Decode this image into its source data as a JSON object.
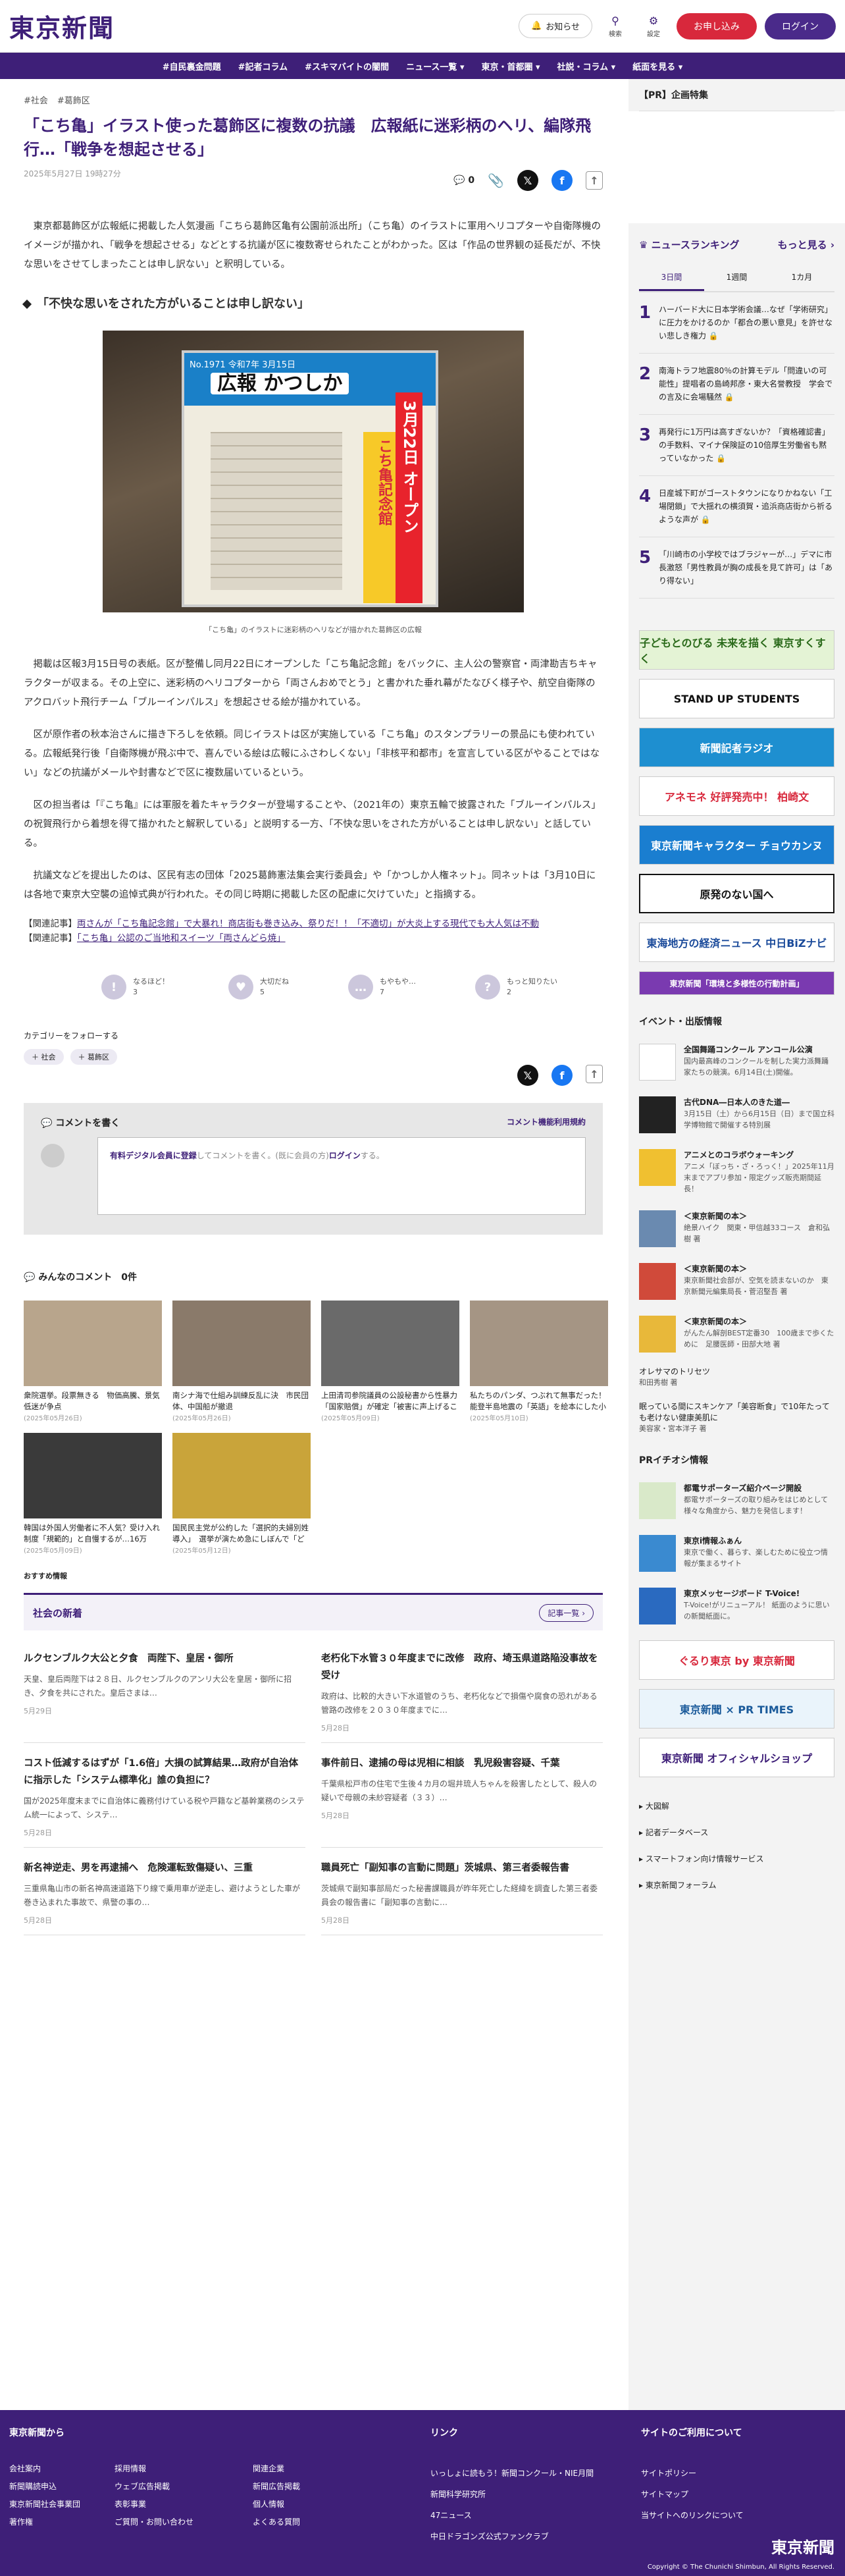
{
  "header": {
    "logo": "東京新聞",
    "notice": "お知らせ",
    "search": "検索",
    "settings": "設定",
    "subscribe": "お申し込み",
    "login": "ログイン"
  },
  "nav": [
    "#自民裏金問題",
    "#記者コラム",
    "#スキマバイトの闇間",
    "ニュース一覧 ▾",
    "東京・首都圏 ▾",
    "社説・コラム ▾",
    "紙面を見る ▾"
  ],
  "article": {
    "tags": [
      "#社会",
      "#葛飾区"
    ],
    "title": "「こち亀」イラスト使った葛飾区に複数の抗議　広報紙に迷彩柄のヘリ、編隊飛行…「戦争を想起させる」",
    "date": "2025年5月27日 19時27分",
    "comment_count": "0",
    "p1": "東京都葛飾区が広報紙に掲載した人気漫画「こちら葛飾区亀有公園前派出所」（こち亀）のイラストに軍用ヘリコプターや自衛隊機のイメージが描かれ、「戦争を想起させる」などとする抗議が区に複数寄せられたことがわかった。区は「作品の世界観の延長だが、不快な思いをさせてしまったことは申し訳ない」と釈明している。",
    "h2": "「不快な思いをされた方がいることは申し訳ない」",
    "photo": {
      "issue": "No.1971 令和7年 3月15日",
      "flyer_title": "広報 かつしか",
      "date_big": "3月22日 オープン",
      "sub": "こち亀記念館"
    },
    "caption": "「こち亀」のイラストに迷彩柄のヘリなどが描かれた葛飾区の広報",
    "p2": "掲載は区報3月15日号の表紙。区が整備し同月22日にオープンした「こち亀記念館」をバックに、主人公の警察官・両津勘吉ちキャラクターが収まる。その上空に、迷彩柄のヘリコプターから「両さんおめでとう」と書かれた垂れ幕がたなびく様子や、航空自衛隊のアクロバット飛行チーム「ブルーインパルス」を想起させる絵が描かれている。",
    "p3": "区が原作者の秋本治さんに描き下ろしを依頼。同じイラストは区が実施している「こち亀」のスタンプラリーの景品にも使われている。広報紙発行後「自衛隊機が飛ぶ中で、喜んでいる絵は広報にふさわしくない」「非核平和都市」を宣言している区がやることではない」などの抗議がメールや封書などで区に複数届いているという。",
    "p4": "区の担当者は「『こち亀』には軍服を着たキャラクターが登場することや、（2021年の）東京五輪で披露された「ブルーインパルス」の祝賀飛行から着想を得て描かれたと解釈している」と説明する一方、「不快な思いをされた方がいることは申し訳ない」と話している。",
    "p5": "抗議文などを提出したのは、区民有志の団体「2025葛飾憲法集会実行委員会」や「かつしか人権ネット」。同ネットは「3月10日には各地で東京大空襲の追悼式典が行われた。その同じ時期に掲載した区の配慮に欠けていた」と指摘する。",
    "rel1_label": "【関連記事】",
    "rel1": "両さんが「こち亀記念館」で大暴れ！商店街も巻き込み、祭りだ！！「不適切」が大炎上する現代でも大人気は不動",
    "rel2_label": "【関連記事】",
    "rel2": "「こち亀」公認のご当地和スイーツ「両さんどら焼」"
  },
  "reactions": [
    {
      "icon": "!",
      "label": "なるほど！",
      "count": "3"
    },
    {
      "icon": "♥",
      "label": "大切だね",
      "count": "5"
    },
    {
      "icon": "…",
      "label": "もやもや…",
      "count": "7"
    },
    {
      "icon": "?",
      "label": "もっと知りたい",
      "count": "2"
    }
  ],
  "follow": {
    "label": "カテゴリーをフォローする",
    "tags": [
      "＋ 社会",
      "＋ 葛飾区"
    ]
  },
  "comment": {
    "head": "コメントを書く",
    "rule": "コメント機能利用規約",
    "prompt_link": "有料デジタル会員に登録",
    "prompt_mid": "してコメントを書く。(既に会員の方)",
    "prompt_login": "ログイン",
    "prompt_end": "する。",
    "all": "みんなのコメント　0件"
  },
  "grid": [
    {
      "t": "衆院選挙。段票無きる　物価高騰、景気低迷が争点",
      "d": "(2025年05月26日)"
    },
    {
      "t": "南シナ海で仕組み訓練反乱に決　市民団体、中国船が撤退",
      "d": "(2025年05月26日)"
    },
    {
      "t": "上田清司参院議員の公設秘書から性暴力「国家賠償」が確定「被害に声上げることため…",
      "d": "(2025年05月09日)"
    },
    {
      "t": "私たちのパンダ、つぶれて無事だった！　能登半島地震の「英語」を絵本にした小学生　作…",
      "d": "(2025年05月10日)"
    },
    {
      "t": "韓国は外国人労働者に不人気？受け入れ制度「規範的」と自慢するが…16万5000人の枠が半…",
      "d": "(2025年05月09日)"
    },
    {
      "t": "国民民主党が公約した「選択的夫婦別姓導入」　選挙が演ため急にしぼんで「どっちつかず…",
      "d": "(2025年05月12日)"
    }
  ],
  "rec": "おすすめ情報",
  "news": {
    "head": "社会の新着",
    "more": "記事一覧 ›",
    "items": [
      {
        "t": "ルクセンブルク大公と夕食　両陛下、皇居・御所",
        "s": "天皇、皇后両陛下は２８日、ルクセンブルクのアンリ大公を皇居・御所に招き、夕食を共にされた。皇后さまは…",
        "d": "5月29日"
      },
      {
        "t": "老朽化下水管３０年度までに改修　政府、埼玉県道路陥没事故を受け",
        "s": "政府は、比較的大きい下水道管のうち、老朽化などで損傷や腐食の恐れがある管路の改修を２０３０年度までに…",
        "d": "5月28日"
      },
      {
        "t": "コスト低減するはずが「1.6倍」大損の試算結果…政府が自治体に指示した「システム標準化」誰の負担に？",
        "s": "国が2025年度末までに自治体に義務付けている税や戸籍など基幹業務のシステム統一によって、システ…",
        "d": "5月28日"
      },
      {
        "t": "事件前日、逮捕の母は児相に相談　乳児殺害容疑、千葉",
        "s": "千葉県松戸市の住宅で生後４カ月の堀井琉人ちゃんを殺害したとして、殺人の疑いで母親の未紗容疑者（３３）…",
        "d": "5月28日"
      },
      {
        "t": "新名神逆走、男を再逮捕へ　危険運転致傷疑い、三重",
        "s": "三重県亀山市の新名神高速道路下り線で乗用車が逆走し、避けようとした車が巻き込まれた事故で、県警の事の…",
        "d": "5月28日"
      },
      {
        "t": "職員死亡「副知事の言動に問題」茨城県、第三者委報告書",
        "s": "茨城県で副知事部局だった秘書課職員が昨年死亡した経緯を調査した第三者委員会の報告書に「副知事の言動に…",
        "d": "5月28日"
      }
    ]
  },
  "side": {
    "pr": "【PR】企画特集",
    "rank_head": "ニュースランキング",
    "rank_more": "もっと見る ›",
    "tabs": [
      "3日間",
      "1週間",
      "1カ月"
    ],
    "rank": [
      {
        "n": "1",
        "t": "ハーバード大に日本学術会議…なぜ「学術研究」に圧力をかけるのか「都合の悪い意見」を許せない悲しき権力 🔒"
      },
      {
        "n": "2",
        "t": "南海トラフ地震80％の計算モデル「問違いの可能性」提唱者の島崎邦彦・東大名誉教授　学会での言及に会場騒然 🔒"
      },
      {
        "n": "3",
        "t": "再発行に1万円は高すぎないか？「資格確認書」の手数料、マイナ保険証の10倍厚生労働省も黙っていなかった 🔒"
      },
      {
        "n": "4",
        "t": "日産城下町がゴーストタウンになりかねない「工場閉鎖」で大揺れの横須賀・追浜商店街から祈るような声が 🔒"
      },
      {
        "n": "5",
        "t": "「川崎市の小学校ではブラジャーが…」デマに市長激怒「男性教員が胸の成長を見て許可」は「あり得ない」"
      }
    ],
    "banners": [
      "子どもとのびる 未来を描く 東京すくすく",
      "STAND UP STUDENTS",
      "新聞記者ラジオ",
      "アネモネ 好評発売中！ 柏崎文",
      "東京新聞キャラクター チョウカンヌ",
      "原発のない国へ",
      "東海地方の経済ニュース 中日BiZナビ",
      "東京新聞「環境と多様性の行動計画」"
    ],
    "ev_head": "イベント・出版情報",
    "events": [
      {
        "t": "全国舞踊コンクール アンコール公演",
        "s": "国内最高峰のコンクールを制した実力派舞踊家たちの競演。6月14日(土)開催。"
      },
      {
        "t": "古代DNA―日本人のきた道―",
        "s": "3月15日（土）から6月15日（日）まで国立科学博物館で開催する特別展"
      },
      {
        "t": "アニメとのコラボウォーキング",
        "s": "アニメ「ぼっち・ざ・ろっく！」2025年11月末までアプリ参加・限定グッズ販売期間延長！"
      },
      {
        "t": "＜東京新聞の本＞",
        "s": "絶景ハイク　関東・甲信越33コース　倉和弘樹 著"
      },
      {
        "t": "＜東京新聞の本＞",
        "s": "東京新聞社会部が、空気を読まないのか　東京新聞元編集局長・菅沼堅吾 著"
      },
      {
        "t": "＜東京新聞の本＞",
        "s": "がんたん解剖BEST定番30　100歳まで歩くために　足腰医師・田部大地 著"
      }
    ],
    "books": [
      {
        "t": "オレサマのトリセツ",
        "s": "和田秀樹 著"
      },
      {
        "t": "眠っている間にスキンケア「美容断食」で10年たっても老けない健康美肌に",
        "s": "美容家・宮本洋子 著"
      }
    ],
    "pr_head": "PRイチオシ情報",
    "prs": [
      {
        "t": "都電サポーターズ紹介ページ開設",
        "s": "都電サポーターズの取り組みをはじめとして様々な角度から、魅力を発信します！"
      },
      {
        "t": "東京i情報ふぁん",
        "s": "東京で働く、暮らす、楽しむために役立つ情報が集まるサイト"
      },
      {
        "t": "東京メッセージボード T-Voice!",
        "s": "T-Voice!がリニューアル！ 紙面のように思いの新聞紙面に。"
      }
    ],
    "pr_banners": [
      "ぐるり東京 by 東京新聞",
      "東京新聞 × PR TIMES",
      "東京新聞 オフィシャルショップ"
    ],
    "links": [
      "大図解",
      "記者データベース",
      "スマートフォン向け情報サービス",
      "東京新聞フォーラム"
    ]
  },
  "footer": {
    "c1": "東京新聞から",
    "c1links": [
      "会社案内",
      "採用情報",
      "関連企業",
      "新聞購読申込",
      "ウェブ広告掲載",
      "新聞広告掲載",
      "東京新聞社会事業団",
      "表彰事業",
      "個人情報",
      "著作権",
      "ご質問・お問い合わせ",
      "よくある質問"
    ],
    "c2": "リンク",
    "c2links": [
      "いっしょに読もう！新聞コンクール・NIE月間",
      "新聞科学研究所",
      "47ニュース",
      "中日ドラゴンズ公式ファンクラブ"
    ],
    "c3": "サイトのご利用について",
    "c3links": [
      "サイトポリシー",
      "サイトマップ",
      "当サイトへのリンクについて"
    ],
    "logo": "東京新聞",
    "copy": "Copyright © The Chunichi Shimbun, All Rights Reserved."
  }
}
